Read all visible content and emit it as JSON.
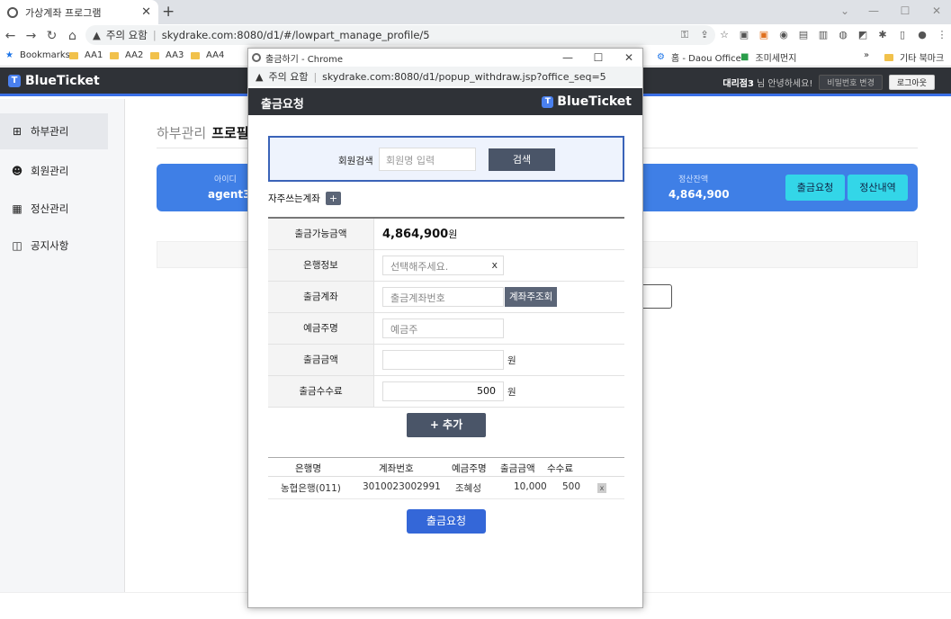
{
  "browser": {
    "tab_title": "가상계좌 프로그램",
    "url_warning": "주의 요함",
    "url": "skydrake.com:8080/d1/#/lowpart_manage_profile/5",
    "bookmarks": [
      "Bookmarks",
      "AA1",
      "AA2",
      "AA3",
      "AA4",
      "홈 - Daou Office",
      "조미세먼지",
      "기타 북마크"
    ],
    "bookmarks_more": "»"
  },
  "app": {
    "brand": "BlueTicket",
    "user_name": "대리점3",
    "greeting": "님 안녕하세요!",
    "change_pw_label": "비밀번호 변경",
    "logout_label": "로그아웃",
    "sidebar": [
      {
        "label": "하부관리",
        "icon": "org-icon"
      },
      {
        "label": "회원관리",
        "icon": "members-icon"
      },
      {
        "label": "정산관리",
        "icon": "calc-icon"
      },
      {
        "label": "공지사항",
        "icon": "notice-icon"
      }
    ],
    "page_title_prefix": "하부관리",
    "page_title": "프로필",
    "card": {
      "id_label": "아이디",
      "id_value": "agent3",
      "balance_label": "정산잔액",
      "balance_value": "4,864,900",
      "withdraw_label": "출금요청",
      "history_label": "정산내역"
    }
  },
  "popup": {
    "window_title": "출금하기 - Chrome",
    "url_warning": "주의 요함",
    "url": "skydrake.com:8080/d1/popup_withdraw.jsp?office_seq=5",
    "header_title": "출금요청",
    "brand": "BlueTicket",
    "search": {
      "label": "회원검색",
      "placeholder": "회원명 입력",
      "button": "검색"
    },
    "favorites_label": "자주쓰는계좌",
    "favorites_add": "+",
    "form": {
      "available_label": "출금가능금액",
      "available_value": "4,864,900",
      "available_unit": "원",
      "bank_label": "은행정보",
      "bank_placeholder": "선택해주세요.",
      "bank_clear": "x",
      "account_label": "출금계좌",
      "account_placeholder": "출금계좌번호",
      "account_lookup": "계좌주조회",
      "holder_label": "예금주명",
      "holder_placeholder": "예금주",
      "amount_label": "출금금액",
      "amount_value": "",
      "amount_unit": "원",
      "fee_label": "출금수수료",
      "fee_value": "500",
      "fee_unit": "원"
    },
    "add_button": "+ 추가",
    "list": {
      "headers": [
        "은행명",
        "계좌번호",
        "예금주명",
        "출금금액",
        "수수료"
      ],
      "rows": [
        {
          "bank": "농협은행(011)",
          "account": "3010023002991",
          "holder": "조혜성",
          "amount": "10,000",
          "fee": "500"
        }
      ],
      "remove_label": "x"
    },
    "submit_button": "출금요청"
  }
}
